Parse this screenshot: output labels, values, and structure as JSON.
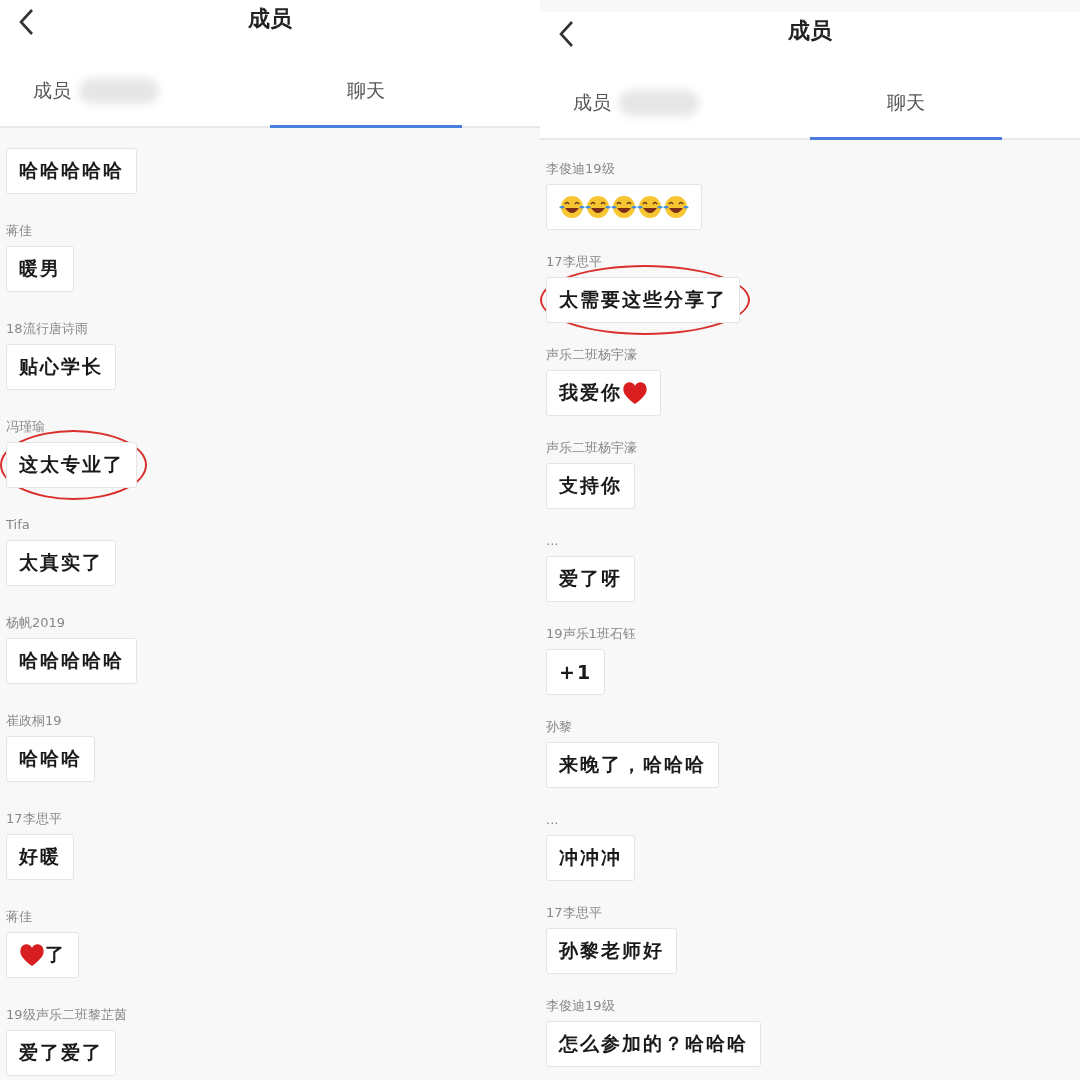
{
  "panels": [
    {
      "title": "成员",
      "tabs": [
        {
          "label": "成员",
          "selected": false,
          "blurred_count": true
        },
        {
          "label": "聊天",
          "selected": true
        }
      ],
      "messages": [
        {
          "parts": [
            {
              "kind": "text",
              "text": "哈哈哈哈哈"
            }
          ],
          "highlighted": false
        },
        {
          "sender": "蒋佳",
          "parts": [
            {
              "kind": "text",
              "text": "暖男"
            }
          ],
          "highlighted": false
        },
        {
          "sender": "18流行唐诗雨",
          "parts": [
            {
              "kind": "text",
              "text": "贴心学长"
            }
          ],
          "highlighted": false
        },
        {
          "sender": "冯瑾瑜",
          "parts": [
            {
              "kind": "text",
              "text": "这太专业了"
            }
          ],
          "highlighted": true
        },
        {
          "sender": "Tifa",
          "parts": [
            {
              "kind": "text",
              "text": "太真实了"
            }
          ],
          "highlighted": false
        },
        {
          "sender": "杨帆2019",
          "parts": [
            {
              "kind": "text",
              "text": "哈哈哈哈哈"
            }
          ],
          "highlighted": false
        },
        {
          "sender": "崔政桐19",
          "parts": [
            {
              "kind": "text",
              "text": "哈哈哈"
            }
          ],
          "highlighted": false
        },
        {
          "sender": "17李思平",
          "parts": [
            {
              "kind": "text",
              "text": "好暖"
            }
          ],
          "highlighted": false
        },
        {
          "sender": "蒋佳",
          "parts": [
            {
              "kind": "heart"
            },
            {
              "kind": "text",
              "text": "了"
            }
          ],
          "highlighted": false
        },
        {
          "sender": "19级声乐二班黎芷茵",
          "parts": [
            {
              "kind": "text",
              "text": "爱了爱了"
            }
          ],
          "highlighted": false
        }
      ]
    },
    {
      "title": "成员",
      "tabs": [
        {
          "label": "成员",
          "selected": false,
          "blurred_count": true
        },
        {
          "label": "聊天",
          "selected": true
        }
      ],
      "messages": [
        {
          "sender": "李俊迪19级",
          "parts": [
            {
              "kind": "laugh"
            },
            {
              "kind": "laugh"
            },
            {
              "kind": "laugh"
            },
            {
              "kind": "laugh"
            },
            {
              "kind": "laugh"
            }
          ],
          "highlighted": false
        },
        {
          "sender": "17李思平",
          "parts": [
            {
              "kind": "text",
              "text": "太需要这些分享了"
            }
          ],
          "highlighted": true
        },
        {
          "sender": "声乐二班杨宇濠",
          "parts": [
            {
              "kind": "text",
              "text": "我爱你"
            },
            {
              "kind": "heart"
            }
          ],
          "highlighted": false
        },
        {
          "sender": "声乐二班杨宇濠",
          "parts": [
            {
              "kind": "text",
              "text": "支持你"
            }
          ],
          "highlighted": false
        },
        {
          "sender": "...",
          "parts": [
            {
              "kind": "text",
              "text": "爱了呀"
            }
          ],
          "highlighted": false
        },
        {
          "sender": "19声乐1班石钰",
          "parts": [
            {
              "kind": "text",
              "text": "+1"
            }
          ],
          "highlighted": false
        },
        {
          "sender": "孙黎",
          "parts": [
            {
              "kind": "text",
              "text": "来晚了，哈哈哈"
            }
          ],
          "highlighted": false
        },
        {
          "sender": "...",
          "parts": [
            {
              "kind": "text",
              "text": "冲冲冲"
            }
          ],
          "highlighted": false
        },
        {
          "sender": "17李思平",
          "parts": [
            {
              "kind": "text",
              "text": "孙黎老师好"
            }
          ],
          "highlighted": false
        },
        {
          "sender": "李俊迪19级",
          "parts": [
            {
              "kind": "text",
              "text": "怎么参加的？哈哈哈"
            }
          ],
          "highlighted": false
        }
      ]
    }
  ]
}
